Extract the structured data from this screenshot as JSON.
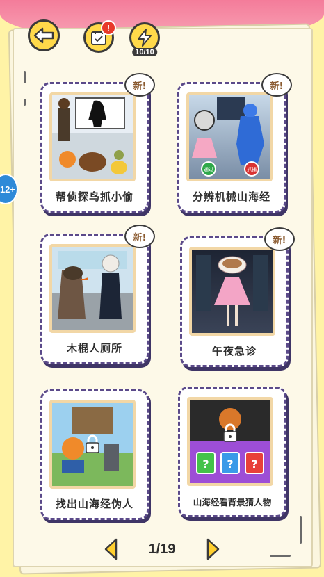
{
  "header": {
    "energy_count": "10/10",
    "calendar_alert": "!"
  },
  "side_badge": {
    "label": "12+"
  },
  "levels": [
    {
      "title": "帮侦探鸟抓小偷",
      "new_label": "新!",
      "locked": false
    },
    {
      "title": "分辨机械山海经",
      "new_label": "新!",
      "locked": false
    },
    {
      "title": "木棍人厕所",
      "new_label": "新!",
      "locked": false
    },
    {
      "title": "午夜急诊",
      "new_label": "新!",
      "locked": false
    },
    {
      "title": "找出山海经伪人",
      "locked": true
    },
    {
      "title": "山海经看背景猜人物",
      "locked": true
    }
  ],
  "level_two_buttons": {
    "left": "通过",
    "right": "抓捕"
  },
  "pager": {
    "page": "1/19"
  },
  "colors": {
    "accent": "#ffd94a",
    "card_border": "#5b4a8a",
    "top_band": "#f47c9a"
  }
}
